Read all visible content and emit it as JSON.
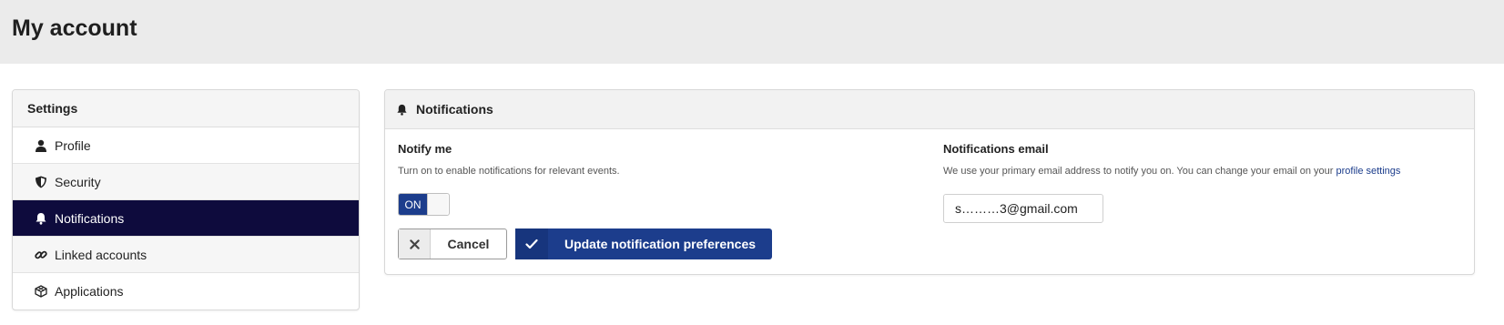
{
  "header": {
    "title": "My account"
  },
  "sidebar": {
    "title": "Settings",
    "items": [
      {
        "label": "Profile",
        "icon": "user-icon"
      },
      {
        "label": "Security",
        "icon": "shield-icon"
      },
      {
        "label": "Notifications",
        "icon": "bell-icon",
        "active": true
      },
      {
        "label": "Linked accounts",
        "icon": "link-icon"
      },
      {
        "label": "Applications",
        "icon": "cube-icon"
      }
    ]
  },
  "panel": {
    "title": "Notifications",
    "notify": {
      "label": "Notify me",
      "help": "Turn on to enable notifications for relevant events.",
      "toggle_label": "ON",
      "toggle_state": true
    },
    "email": {
      "label": "Notifications email",
      "help": "We use your primary email address to notify you on. You can change your email on your",
      "link": "profile settings",
      "value": "s………3@gmail.com"
    },
    "buttons": {
      "cancel": "Cancel",
      "update": "Update notification preferences"
    }
  },
  "colors": {
    "topbar": "#ebebeb",
    "active_nav": "#0e0b3d",
    "primary": "#1c3d8c",
    "link": "#1c3d8c"
  }
}
